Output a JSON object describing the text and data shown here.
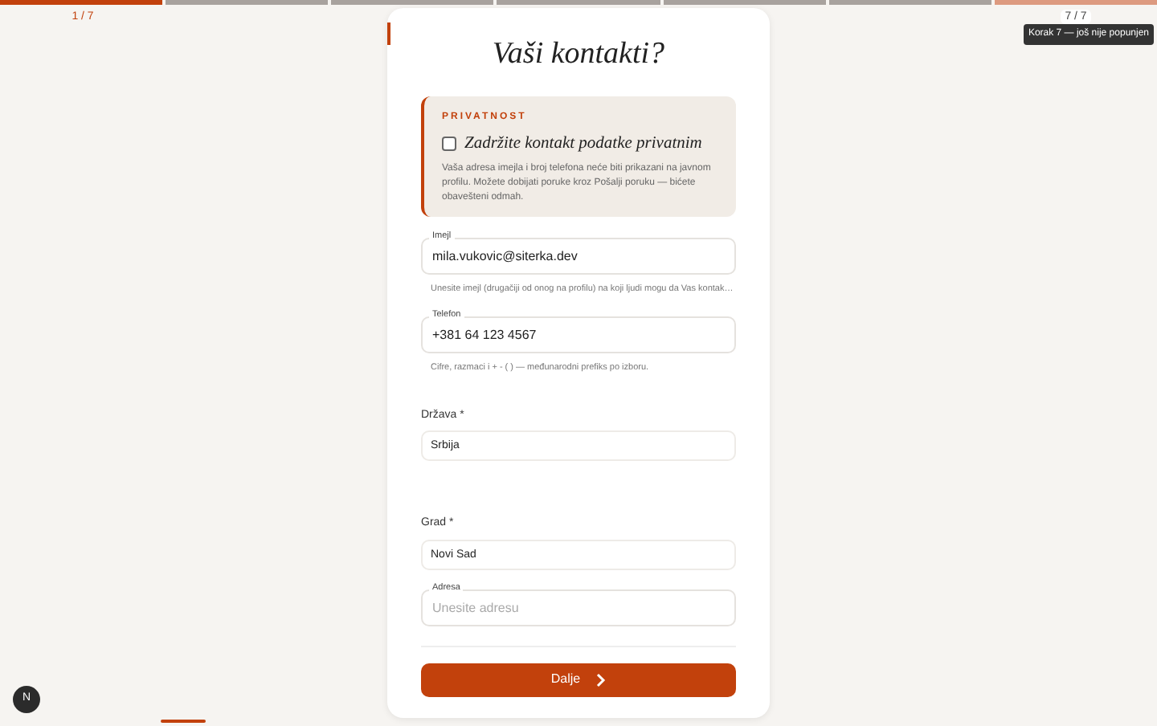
{
  "progress": {
    "segments": [
      {
        "selected": true,
        "hovered": false,
        "label": "1 / 7"
      },
      {
        "selected": false,
        "hovered": false
      },
      {
        "selected": false,
        "hovered": false
      },
      {
        "selected": false,
        "hovered": false
      },
      {
        "selected": false,
        "hovered": false
      },
      {
        "selected": false,
        "hovered": false
      },
      {
        "selected": false,
        "hovered": true,
        "label": "7 / 7",
        "tooltip": "Korak 7 — još nije popunjen"
      }
    ]
  },
  "title": "Vaši kontakti?",
  "privacy": {
    "eyebrow": "PRIVATNOST",
    "checkbox_label": "Zadržite kontakt podatke privatnim",
    "checked": false,
    "text": "Vaša adresa imejla i broj telefona neće biti prikazani na javnom profilu. Možete dobijati poruke kroz Pošalji poruku — bićete obavešteni odmah."
  },
  "fields": [
    {
      "kind": "floating",
      "label": "Imejl",
      "value": "mila.vukovic@siterka.dev",
      "hint": "Unesite imejl (drugačiji od onog na profilu) na koji ljudi mogu da Vas kontak…"
    },
    {
      "kind": "floating",
      "label": "Telefon",
      "value": "+381 64 123 4567",
      "hint": "Cifre, razmaci i + - ( ) — međunarodni prefiks po izboru."
    },
    {
      "kind": "stacked",
      "label": "Država *",
      "value": "Srbija"
    },
    {
      "kind": "stacked",
      "label": "Grad *",
      "value": "Novi Sad"
    },
    {
      "kind": "floating",
      "label": "Adresa",
      "placeholder": "Unesite adresu"
    }
  ],
  "next_button": {
    "label": "Dalje"
  },
  "avatar": "N"
}
